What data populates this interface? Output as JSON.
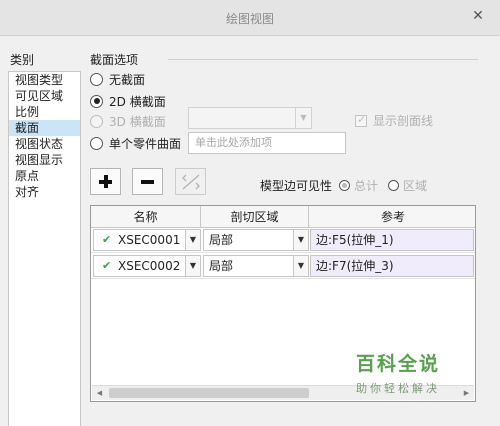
{
  "window": {
    "title": "绘图视图",
    "close_glyph": "✕"
  },
  "categories": {
    "label": "类别",
    "items": [
      {
        "label": "视图类型"
      },
      {
        "label": "可见区域"
      },
      {
        "label": "比例"
      },
      {
        "label": "截面",
        "selected": true
      },
      {
        "label": "视图状态"
      },
      {
        "label": "视图显示"
      },
      {
        "label": "原点"
      },
      {
        "label": "对齐"
      }
    ]
  },
  "section_options": {
    "label": "截面选项",
    "options": [
      {
        "label": "无截面",
        "selected": false,
        "enabled": true
      },
      {
        "label": "2D 横截面",
        "selected": true,
        "enabled": true
      },
      {
        "label": "3D 横截面",
        "selected": false,
        "enabled": false
      },
      {
        "label": "单个零件曲面",
        "selected": false,
        "enabled": true
      }
    ],
    "show_xsec_checkbox": {
      "label": "显示剖面线",
      "checked": true,
      "enabled": false
    },
    "add_item_placeholder": "单击此处添加项"
  },
  "toolbar": {
    "add_icon": "plus-icon",
    "remove_icon": "minus-icon",
    "flip_icon": "flip-arrow-icon"
  },
  "visibility": {
    "label": "模型边可见性",
    "options": [
      {
        "label": "总计",
        "selected": true
      },
      {
        "label": "区域",
        "selected": false
      }
    ]
  },
  "table": {
    "columns": [
      "名称",
      "剖切区域",
      "参考"
    ],
    "rows": [
      {
        "name": "XSEC0001",
        "region": "局部",
        "reference": "边:F5(拉伸_1)",
        "valid": true
      },
      {
        "name": "XSEC0002",
        "region": "局部",
        "reference": "边:F7(拉伸_3)",
        "valid": true
      }
    ]
  },
  "watermark": {
    "title": "百科全说",
    "subtitle": "助你轻松解决"
  },
  "colors": {
    "selection": "#cce4f7",
    "check": "#2fa64a",
    "reference_cell": "#f1ecfb",
    "watermark": "#56a14b"
  }
}
